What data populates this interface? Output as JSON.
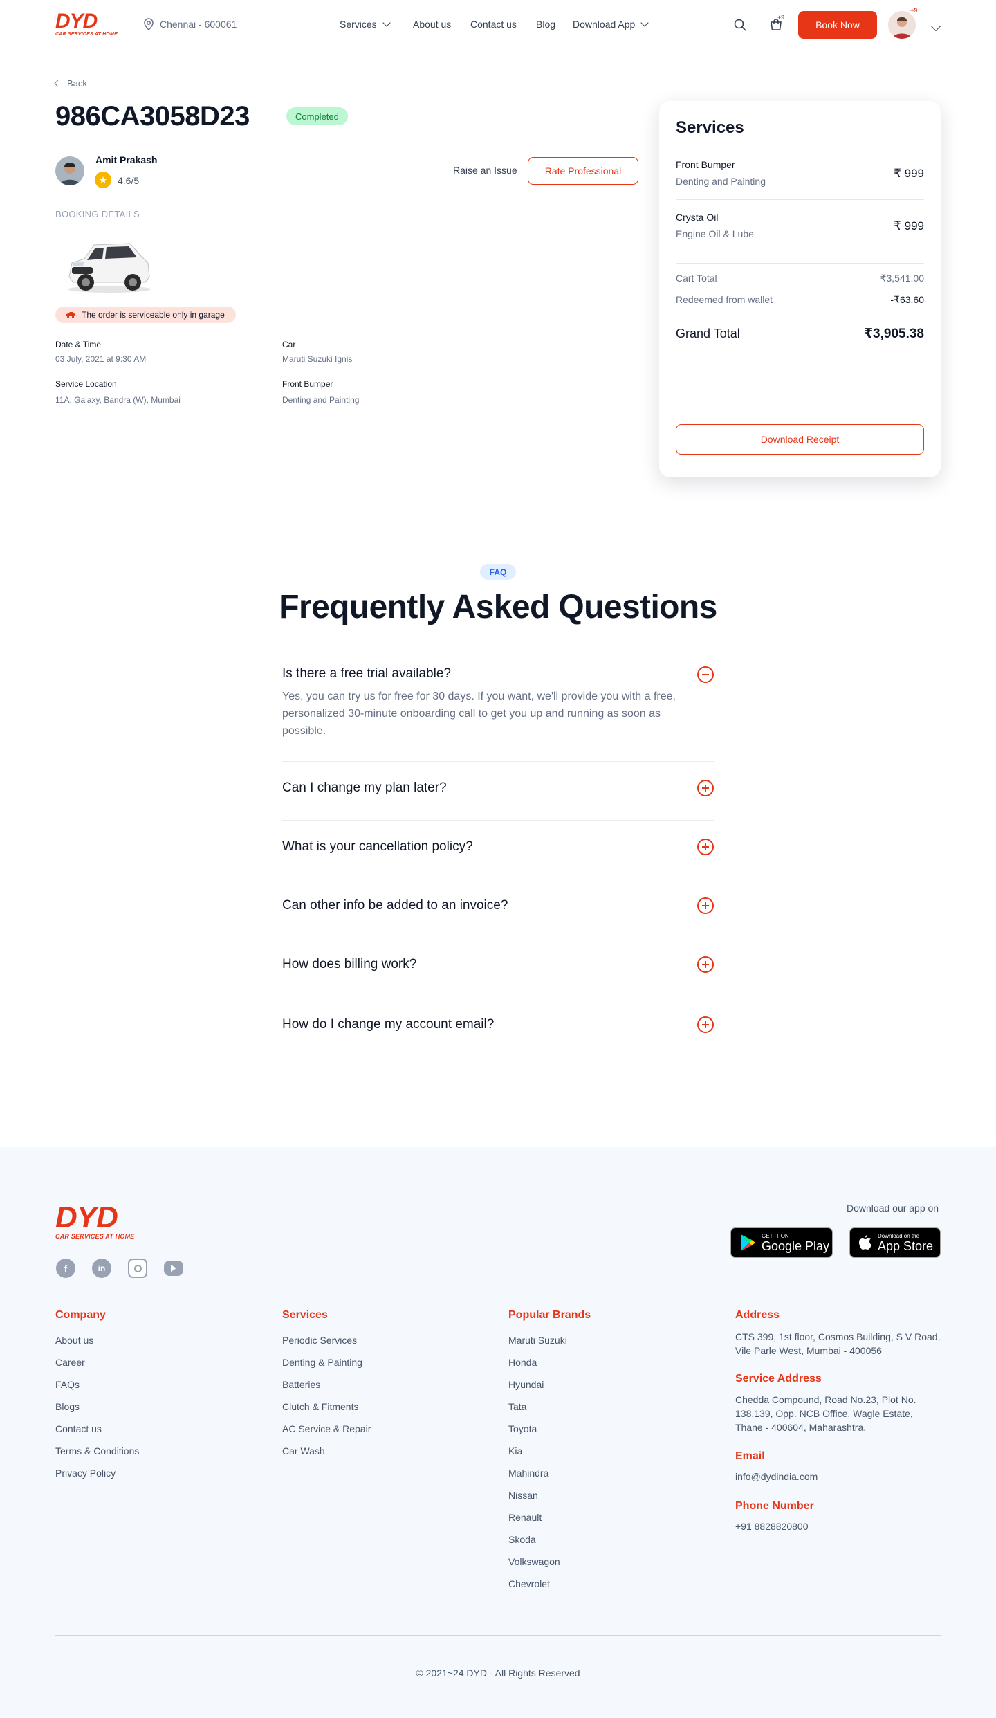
{
  "brand": {
    "word": "DYD",
    "tagline": "CAR SERVICES AT HOME",
    "accent": "#e63617"
  },
  "header": {
    "location": "Chennai - 600061",
    "nav": [
      "Services",
      "About us",
      "Contact us",
      "Blog",
      "Download App"
    ],
    "cart_badge": "+9",
    "book_label": "Book Now",
    "profile_badge": "+9"
  },
  "booking": {
    "back_label": "Back",
    "id": "986CA3058D23",
    "status": "Completed",
    "professional": {
      "name": "Amit Prakash",
      "rating": "4.6/5"
    },
    "raise_label": "Raise an Issue",
    "rate_label": "Rate Professional",
    "section_label": "BOOKING DETAILS",
    "garage_note": "The order is serviceable only in garage",
    "details": {
      "date_label": "Date & Time",
      "date_value": "03 July, 2021 at 9:30 AM",
      "car_label": "Car",
      "car_value": "Maruti Suzuki Ignis",
      "location_label": "Service Location",
      "location_value": "11A, Galaxy, Bandra (W), Mumbai",
      "service_label": "Front Bumper",
      "service_value": "Denting and Painting"
    }
  },
  "summary": {
    "title": "Services",
    "items": [
      {
        "name": "Front Bumper",
        "sub": "Denting and Painting",
        "price": "₹ 999"
      },
      {
        "name": "Crysta Oil",
        "sub": "Engine Oil & Lube",
        "price": "₹ 999"
      }
    ],
    "cart_total_label": "Cart Total",
    "cart_total": "₹3,541.00",
    "wallet_label": "Redeemed from wallet",
    "wallet": "-₹63.60",
    "grand_total_label": "Grand Total",
    "grand_total": "₹3,905.38",
    "download_label": "Download Receipt"
  },
  "faq": {
    "tag": "FAQ",
    "title": "Frequently Asked Questions",
    "items": [
      {
        "q": "Is there a free trial available?",
        "a": "Yes, you can try us for free for 30 days. If you want, we'll provide you with a free, personalized 30-minute onboarding call to get you up and running as soon as possible."
      },
      {
        "q": "Can I change my plan later?"
      },
      {
        "q": "What is your cancellation policy?"
      },
      {
        "q": "Can other info be added to an invoice?"
      },
      {
        "q": "How does billing work?"
      },
      {
        "q": "How do I change my account email?"
      }
    ]
  },
  "footer": {
    "download_label": "Download our app on",
    "google": {
      "small": "GET IT ON",
      "large": "Google Play"
    },
    "apple": {
      "small": "Download on the",
      "large": "App Store"
    },
    "social_icons": [
      "facebook-icon",
      "linkedin-icon",
      "instagram-icon",
      "youtube-icon"
    ],
    "company": {
      "title": "Company",
      "links": [
        "About us",
        "Career",
        "FAQs",
        "Blogs",
        "Contact us",
        "Terms & Conditions",
        "Privacy Policy"
      ]
    },
    "services": {
      "title": "Services",
      "links": [
        "Periodic Services",
        "Denting & Painting",
        "Batteries",
        "Clutch & Fitments",
        "AC Service & Repair",
        "Car Wash"
      ]
    },
    "brands": {
      "title": "Popular Brands",
      "links": [
        "Maruti Suzuki",
        "Honda",
        "Hyundai",
        "Tata",
        "Toyota",
        "Kia",
        "Mahindra",
        "Nissan",
        "Renault",
        "Skoda",
        "Volkswagon",
        "Chevrolet"
      ]
    },
    "address_title": "Address",
    "address": "CTS 399, 1st floor, Cosmos Building, S V Road, Vile Parle West, Mumbai - 400056",
    "service_address_title": "Service Address",
    "service_address": "Chedda Compound, Road No.23, Plot No. 138,139, Opp. NCB Office, Wagle Estate, Thane - 400604, Maharashtra.",
    "email_title": "Email",
    "email": "info@dydindia.com",
    "phone_title": "Phone Number",
    "phone": "+91 8828820800",
    "copyright": "© 2021~24 DYD - All Rights Reserved"
  }
}
